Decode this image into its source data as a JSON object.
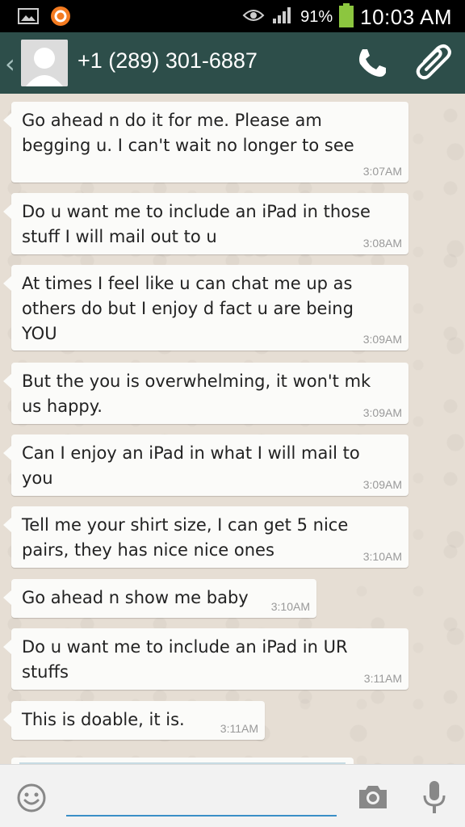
{
  "status_bar": {
    "icons": [
      "gallery-icon",
      "notification-app-icon",
      "eye-icon",
      "signal-icon",
      "battery-icon"
    ],
    "battery_percent": "91%",
    "time": "10:03 AM",
    "battery_color": "#8cc63f"
  },
  "header": {
    "contact_name": "+1 (289) 301-6887",
    "icons": [
      "back-chevron-icon",
      "avatar-placeholder-icon",
      "phone-call-icon",
      "paperclip-icon"
    ],
    "background_color": "#2d4e4a"
  },
  "messages": [
    {
      "text": "Go ahead n do it for me. Please am\nbegging u. I can't wait no longer to see",
      "time": "3:07AM"
    },
    {
      "text": "Do u want me to include an iPad in those\nstuff I will mail out to u",
      "time": "3:08AM"
    },
    {
      "text": "At times I feel like u can chat me up as\nothers do but I enjoy d fact u are being\nYOU",
      "time": "3:09AM"
    },
    {
      "text": "But the you is overwhelming, it won't mk\nus happy.",
      "time": "3:09AM"
    },
    {
      "text": "Can I enjoy an iPad in what I will mail to\nyou",
      "time": "3:09AM"
    },
    {
      "text": "Tell me your shirt size, I can get 5 nice\npairs, they has nice nice ones",
      "time": "3:10AM"
    },
    {
      "text": "Go ahead n show me baby",
      "time": "3:10AM"
    },
    {
      "text": "Do u want me to include an iPad in UR\nstuffs",
      "time": "3:11AM"
    },
    {
      "text": "This is doable, it is.",
      "time": "3:11AM"
    }
  ],
  "input_bar": {
    "placeholder": "",
    "icons": [
      "emoji-icon",
      "camera-icon",
      "microphone-icon"
    ],
    "accent_color": "#3a8fc7"
  }
}
